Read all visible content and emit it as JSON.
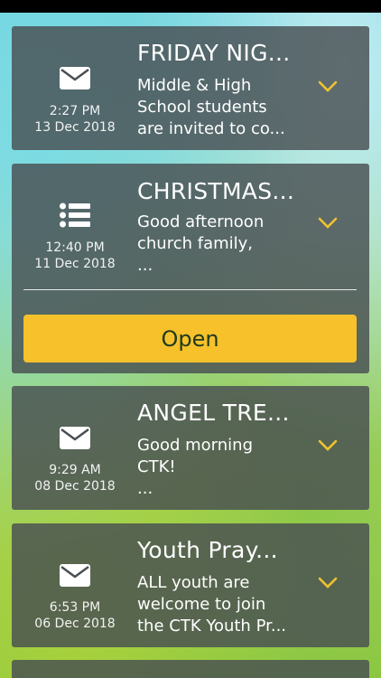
{
  "messages": [
    {
      "icon": "mail-icon",
      "title": "FRIDAY NIG...",
      "body": "Middle & High\nSchool students\nare invited to co...",
      "time": "2:27 PM",
      "date": "13 Dec 2018"
    },
    {
      "icon": "list-icon",
      "title": "CHRISTMAS...",
      "body": "Good afternoon\nchurch family,\n...",
      "time": "12:40 PM",
      "date": "11 Dec 2018",
      "open_label": "Open"
    },
    {
      "icon": "mail-icon",
      "title": "ANGEL TRE...",
      "body": "Good morning\nCTK!\n...",
      "time": "9:29 AM",
      "date": "08 Dec 2018"
    },
    {
      "icon": "mail-icon",
      "title": "Youth Pray...",
      "body": "ALL youth are\nwelcome to join\nthe CTK Youth Pr...",
      "time": "6:53 PM",
      "date": "06 Dec 2018"
    }
  ],
  "colors": {
    "accent": "#f6c12b",
    "card": "#484e52",
    "chevron": "#f2c230"
  }
}
